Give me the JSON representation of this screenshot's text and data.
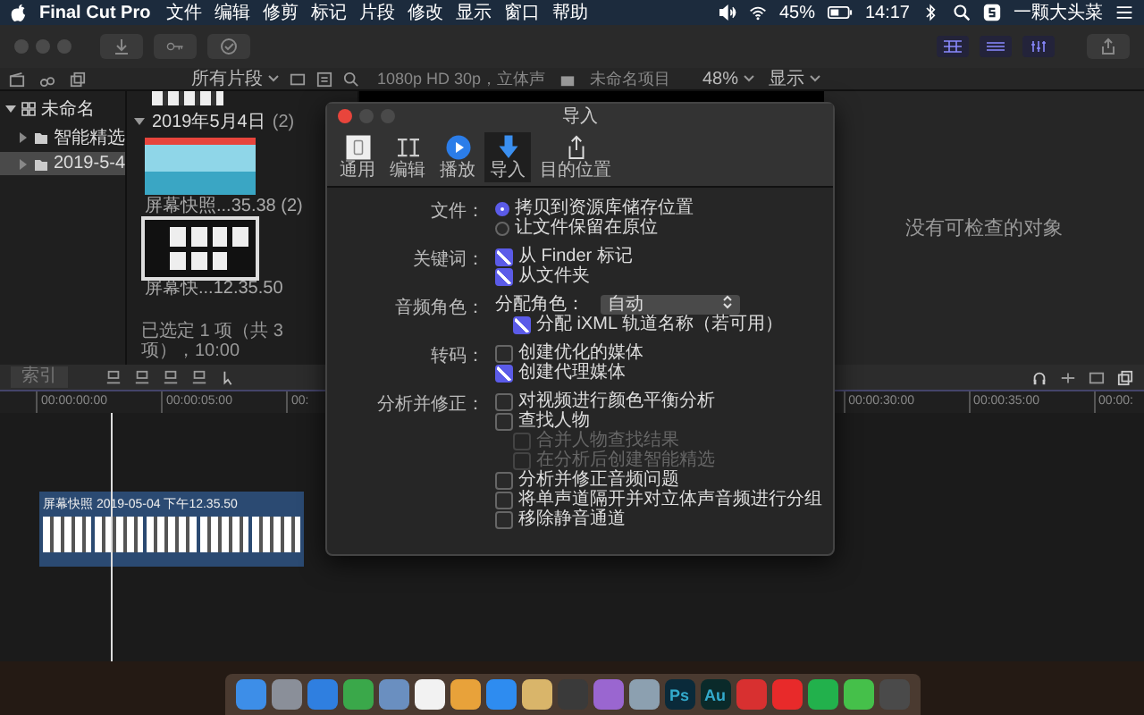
{
  "menubar": {
    "app": "Final Cut Pro",
    "menus": [
      "文件",
      "编辑",
      "修剪",
      "标记",
      "片段",
      "修改",
      "显示",
      "窗口",
      "帮助"
    ],
    "battery": "45%",
    "time": "14:17",
    "user": "一颗大头菜"
  },
  "browser_header": {
    "filter": "所有片段",
    "format": "1080p HD 30p，立体声",
    "project": "未命名项目",
    "zoom": "48%",
    "view": "显示"
  },
  "library": [
    {
      "label": "未命名",
      "expanded": true,
      "selected": false,
      "children": [
        {
          "label": "智能精选",
          "expanded": false,
          "selected": false
        },
        {
          "label": "2019-5-4",
          "expanded": false,
          "selected": true
        }
      ]
    }
  ],
  "browser": {
    "group": "2019年5月4日",
    "count": "(2)",
    "clips": [
      {
        "kind": "cartoon",
        "caption": "屏幕快照...35.38 (2)",
        "selected": false
      },
      {
        "kind": "screens",
        "caption": "屏幕快...12.35.50",
        "selected": true
      }
    ],
    "status": "已选定 1 项（共 3 项），10:00"
  },
  "inspector": {
    "message": "没有可检查的对象"
  },
  "timeline": {
    "index_label": "索引",
    "ruler_left": [
      "00:00:00:00",
      "00:00:05:00",
      "00:"
    ],
    "ruler_right": [
      "00:00:30:00",
      "00:00:35:00",
      "00:00:"
    ],
    "clip": {
      "title": "屏幕快照 2019-05-04 下午12.35.50"
    }
  },
  "dialog": {
    "title": "导入",
    "tabs": [
      {
        "kind": "general",
        "label": "通用",
        "selected": false
      },
      {
        "kind": "edit",
        "label": "编辑",
        "selected": false
      },
      {
        "kind": "playback",
        "label": "播放",
        "selected": false
      },
      {
        "kind": "import",
        "label": "导入",
        "selected": true
      },
      {
        "kind": "destination",
        "label": "目的位置",
        "selected": false
      }
    ],
    "sections": [
      {
        "label": "文件：",
        "items": [
          {
            "kind": "radio",
            "text": "拷贝到资源库储存位置",
            "checked": true
          },
          {
            "kind": "radio",
            "text": "让文件保留在原位",
            "checked": false
          }
        ]
      },
      {
        "label": "关键词：",
        "items": [
          {
            "kind": "checkbox",
            "text": "从 Finder 标记",
            "checked": true
          },
          {
            "kind": "checkbox",
            "text": "从文件夹",
            "checked": true
          }
        ]
      },
      {
        "label": "音频角色：",
        "items": [
          {
            "kind": "select",
            "text": "分配角色：",
            "value": "自动",
            "children": [
              {
                "text": "分配 iXML 轨道名称（若可用）",
                "checked": true
              }
            ]
          }
        ]
      },
      {
        "label": "转码：",
        "items": [
          {
            "kind": "checkbox",
            "text": "创建优化的媒体",
            "checked": false
          },
          {
            "kind": "checkbox",
            "text": "创建代理媒体",
            "checked": true
          }
        ]
      },
      {
        "label": "分析并修正：",
        "items": [
          {
            "kind": "checkbox",
            "text": "对视频进行颜色平衡分析",
            "checked": false
          },
          {
            "kind": "checkbox",
            "text": "查找人物",
            "checked": false,
            "children": [
              {
                "text": "合并人物查找结果",
                "checked": false,
                "disabled": true
              },
              {
                "text": "在分析后创建智能精选",
                "checked": false,
                "disabled": true
              }
            ]
          },
          {
            "kind": "checkbox",
            "text": "分析并修正音频问题",
            "checked": false
          },
          {
            "kind": "checkbox",
            "text": "将单声道隔开并对立体声音频进行分组",
            "checked": false
          },
          {
            "kind": "checkbox",
            "text": "移除静音通道",
            "checked": false
          }
        ]
      }
    ]
  },
  "dock": [
    {
      "color": "#3d8ee8"
    },
    {
      "color": "#8a8f99"
    },
    {
      "color": "#2f7fe0"
    },
    {
      "color": "#3aa84a"
    },
    {
      "color": "#6a8fc0"
    },
    {
      "color": "#f2f2f2"
    },
    {
      "color": "#e8a23a"
    },
    {
      "color": "#2e8cf0"
    },
    {
      "color": "#d9b56a"
    },
    {
      "color": "#3a3a3a"
    },
    {
      "color": "#9a66d0"
    },
    {
      "color": "#8ca0b0"
    },
    {
      "color": "#0a2a3a",
      "label": "Ps"
    },
    {
      "color": "#0a2a2a",
      "label": "Au"
    },
    {
      "color": "#d83030"
    },
    {
      "color": "#e82a2a"
    },
    {
      "color": "#22b14c"
    },
    {
      "color": "#45c04a"
    },
    {
      "color": "#4a4a4a"
    }
  ]
}
